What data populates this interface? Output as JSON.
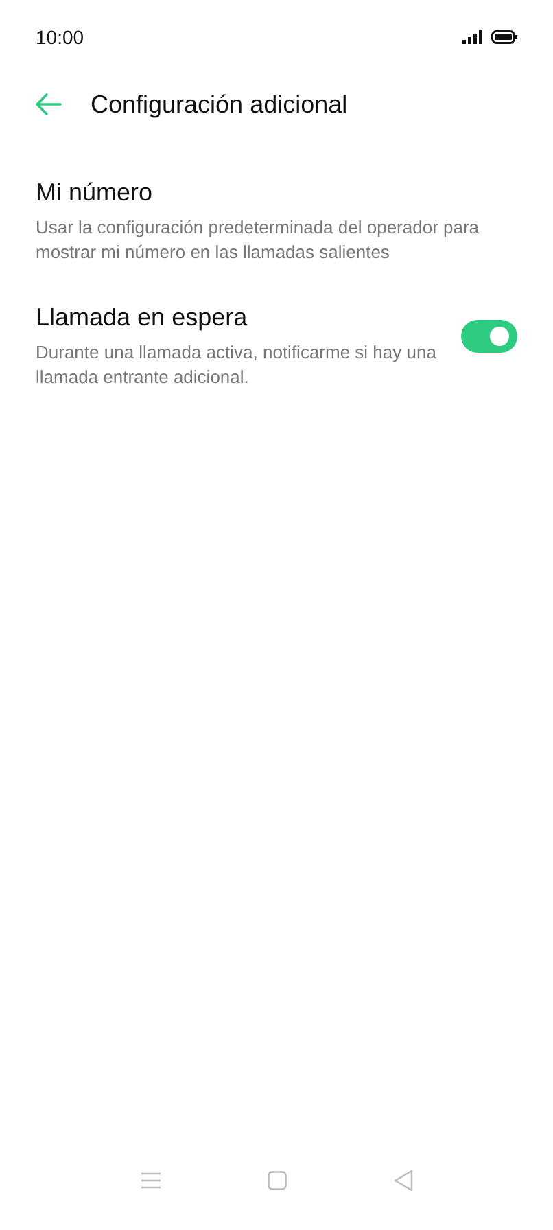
{
  "status_bar": {
    "time": "10:00"
  },
  "header": {
    "title": "Configuración adicional"
  },
  "settings": [
    {
      "kind": "plain",
      "title": "Mi número",
      "description": "Usar la configuración predeterminada del operador para mostrar mi número en las llamadas salientes"
    },
    {
      "kind": "toggle",
      "title": "Llamada en espera",
      "description": "Durante una llamada activa, notificarme si hay una llamada entrante adicional.",
      "on": true
    }
  ]
}
